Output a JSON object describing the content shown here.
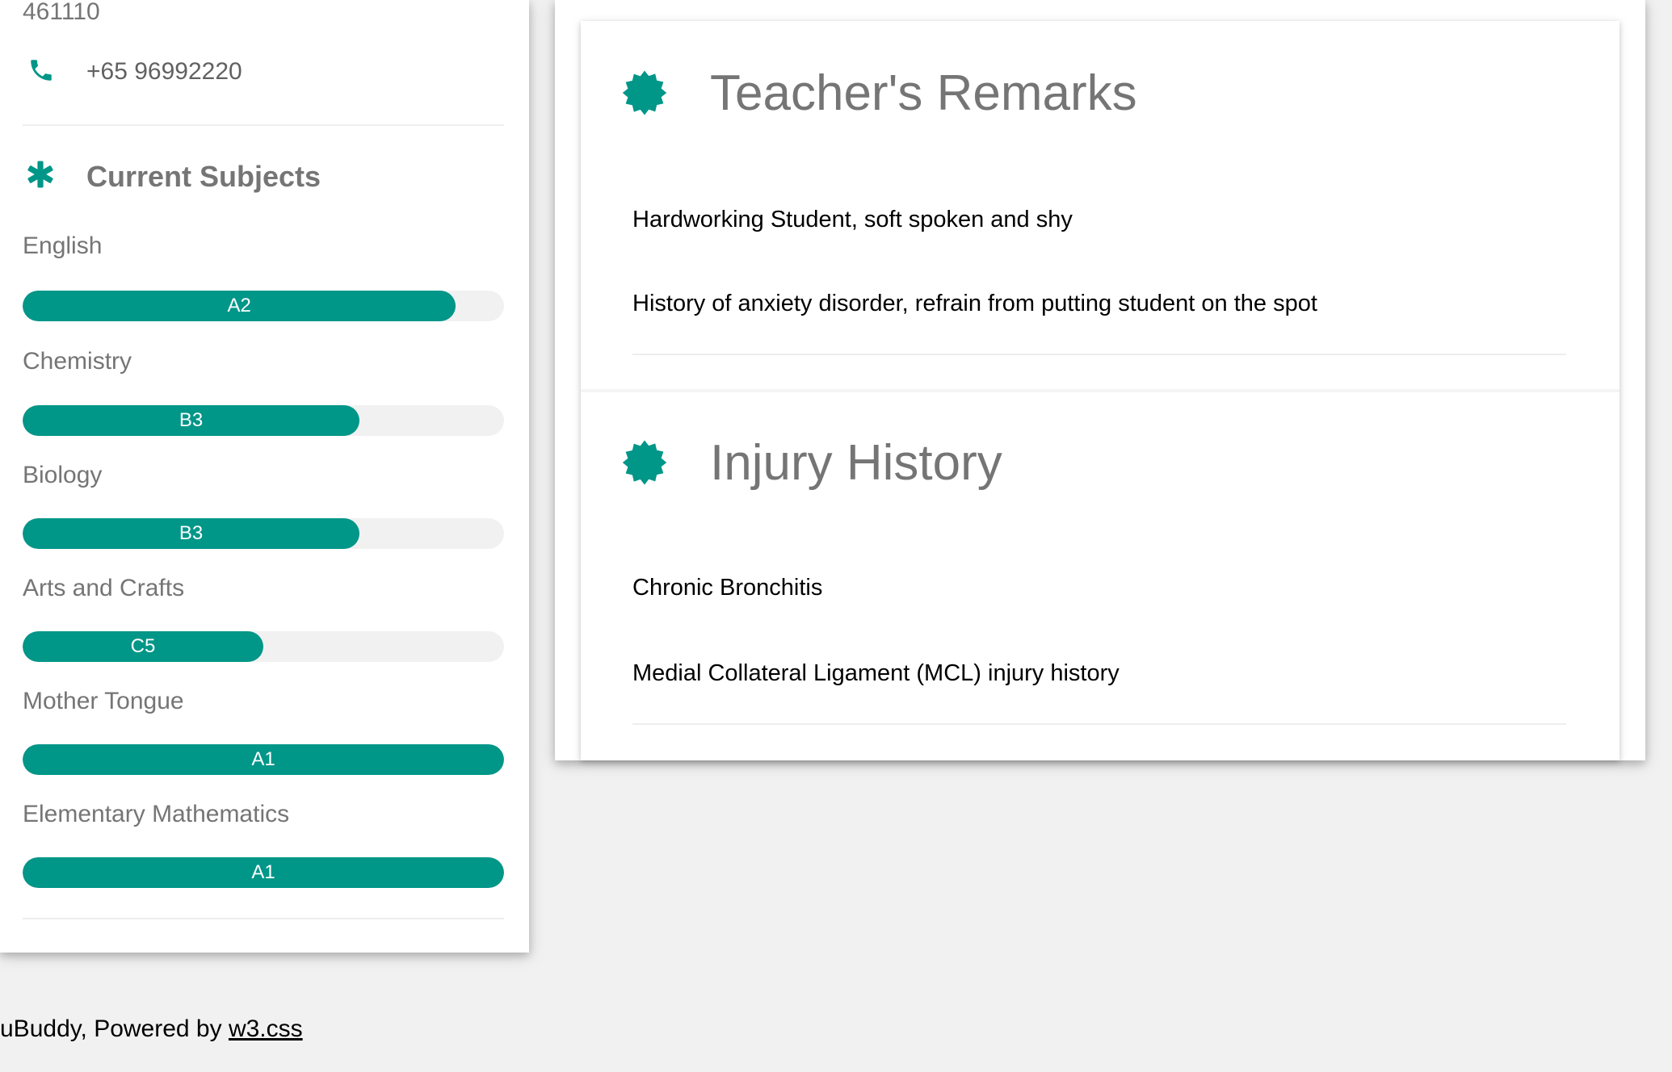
{
  "contact": {
    "postal_code": "461110",
    "phone": "+65 96992220"
  },
  "subjects": {
    "title": "Current Subjects",
    "items": [
      {
        "label": "English",
        "grade": "A2",
        "progress": 90
      },
      {
        "label": "Chemistry",
        "grade": "B3",
        "progress": 70
      },
      {
        "label": "Biology",
        "grade": "B3",
        "progress": 70
      },
      {
        "label": "Arts and Crafts",
        "grade": "C5",
        "progress": 50
      },
      {
        "label": "Mother Tongue",
        "grade": "A1",
        "progress": 100
      },
      {
        "label": "Elementary Mathematics",
        "grade": "A1",
        "progress": 100
      }
    ]
  },
  "remarks": {
    "title": "Teacher's Remarks",
    "lines": [
      "Hardworking Student, soft spoken and shy",
      "History of anxiety disorder, refrain from putting student on the spot"
    ]
  },
  "injury": {
    "title": "Injury History",
    "lines": [
      "Chronic Bronchitis",
      "Medial Collateral Ligament (MCL) injury history"
    ]
  },
  "footer": {
    "text": "uBuddy, Powered by ",
    "link": "w3.css"
  },
  "colors": {
    "accent": "#009688",
    "track": "#f1f1f1",
    "muted_text": "#757575"
  },
  "icons": {
    "phone": "phone-icon",
    "subjects": "asterisk-icon",
    "section": "certificate-icon"
  }
}
